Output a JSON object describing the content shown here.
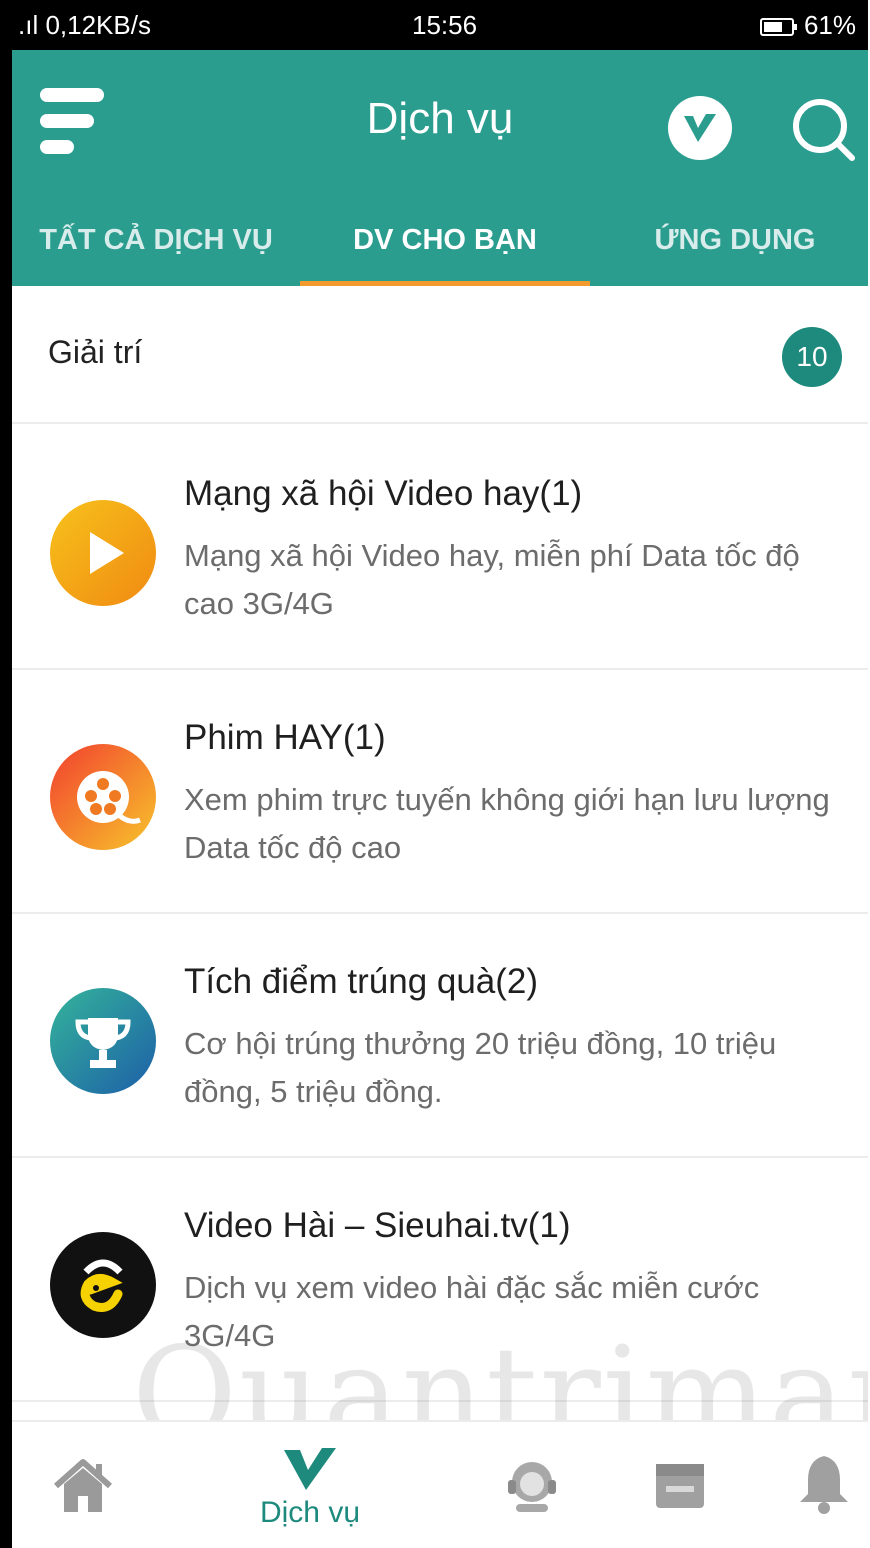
{
  "status_bar": {
    "left": ".ıl 0,12KB/s",
    "time": "15:56",
    "right": "61%"
  },
  "header": {
    "title": "Dịch vụ",
    "icons": [
      "menu-icon",
      "viettel-v-icon",
      "search-icon"
    ]
  },
  "tabs": [
    {
      "label": "TẤT CẢ DỊCH VỤ",
      "active": false
    },
    {
      "label": "DV CHO BẠN",
      "active": true
    },
    {
      "label": "ỨNG DỤNG",
      "active": false
    }
  ],
  "section": {
    "title": "Giải trí",
    "count": "10"
  },
  "services": [
    {
      "title": "Mạng xã hội Video hay(1)",
      "description": "Mạng xã hội Video hay, miễn phí Data tốc độ cao 3G/4G",
      "icon": "play-icon"
    },
    {
      "title": "Phim HAY(1)",
      "description": "Xem phim trực tuyến không giới hạn lưu lượng Data tốc độ cao",
      "icon": "film-reel-icon"
    },
    {
      "title": "Tích điểm trúng quà(2)",
      "description": "Cơ hội trúng thưởng 20 triệu đồng, 10 triệu đồng, 5 triệu đồng.",
      "icon": "trophy-icon"
    },
    {
      "title": "Video Hài – Sieuhai.tv(1)",
      "description": "Dịch vụ xem video hài đặc sắc miễn cước 3G/4G",
      "icon": "sieuhai-logo-icon"
    }
  ],
  "bottom_nav": {
    "items": [
      {
        "label": "",
        "icon": "home-icon"
      },
      {
        "label": "Dịch vụ",
        "icon": "viettel-v-icon",
        "active": true
      },
      {
        "label": "",
        "icon": "support-agent-icon"
      },
      {
        "label": "",
        "icon": "store-icon"
      },
      {
        "label": "",
        "icon": "bell-icon"
      }
    ]
  },
  "watermark": "Quantrimang",
  "colors": {
    "primary": "#2a9d8f",
    "badge": "#1d8a7d",
    "tab_indicator": "#f29a2e"
  }
}
